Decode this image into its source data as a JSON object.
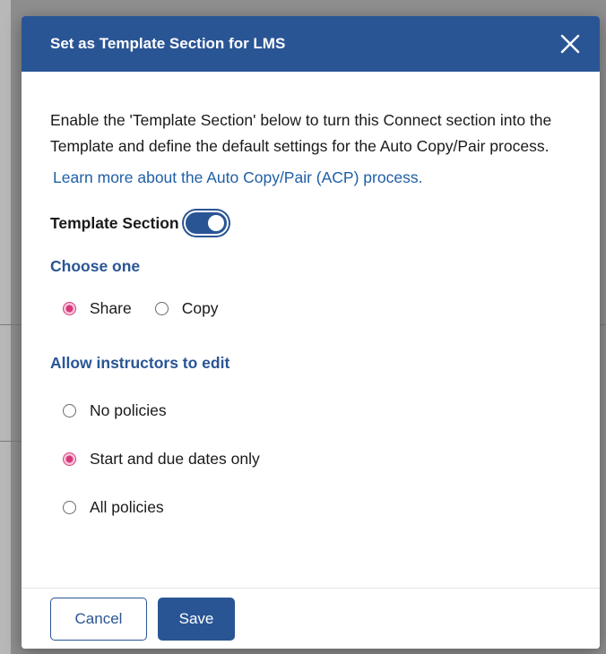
{
  "dialog": {
    "title": "Set as Template Section for LMS",
    "close_icon": "close-icon",
    "description": "Enable the 'Template Section' below to turn this Connect section into the Template and define the default settings for the Auto Copy/Pair process.",
    "learn_more_link": "Learn more about the Auto Copy/Pair (ACP) process.",
    "template_toggle": {
      "label": "Template Section",
      "enabled": true
    },
    "choose_one": {
      "title": "Choose one",
      "options": [
        {
          "label": "Share",
          "selected": true
        },
        {
          "label": "Copy",
          "selected": false
        }
      ]
    },
    "allow_edit": {
      "title": "Allow instructors to edit",
      "options": [
        {
          "label": "No policies",
          "selected": false
        },
        {
          "label": "Start and due dates only",
          "selected": true
        },
        {
          "label": "All policies",
          "selected": false
        }
      ]
    },
    "footer": {
      "cancel_label": "Cancel",
      "save_label": "Save"
    }
  },
  "colors": {
    "header": "#2a5595",
    "accent": "#2a5595",
    "link": "#1f5fa6",
    "radio_selected": "#d9387a",
    "overlay": "#8e8e8e"
  }
}
